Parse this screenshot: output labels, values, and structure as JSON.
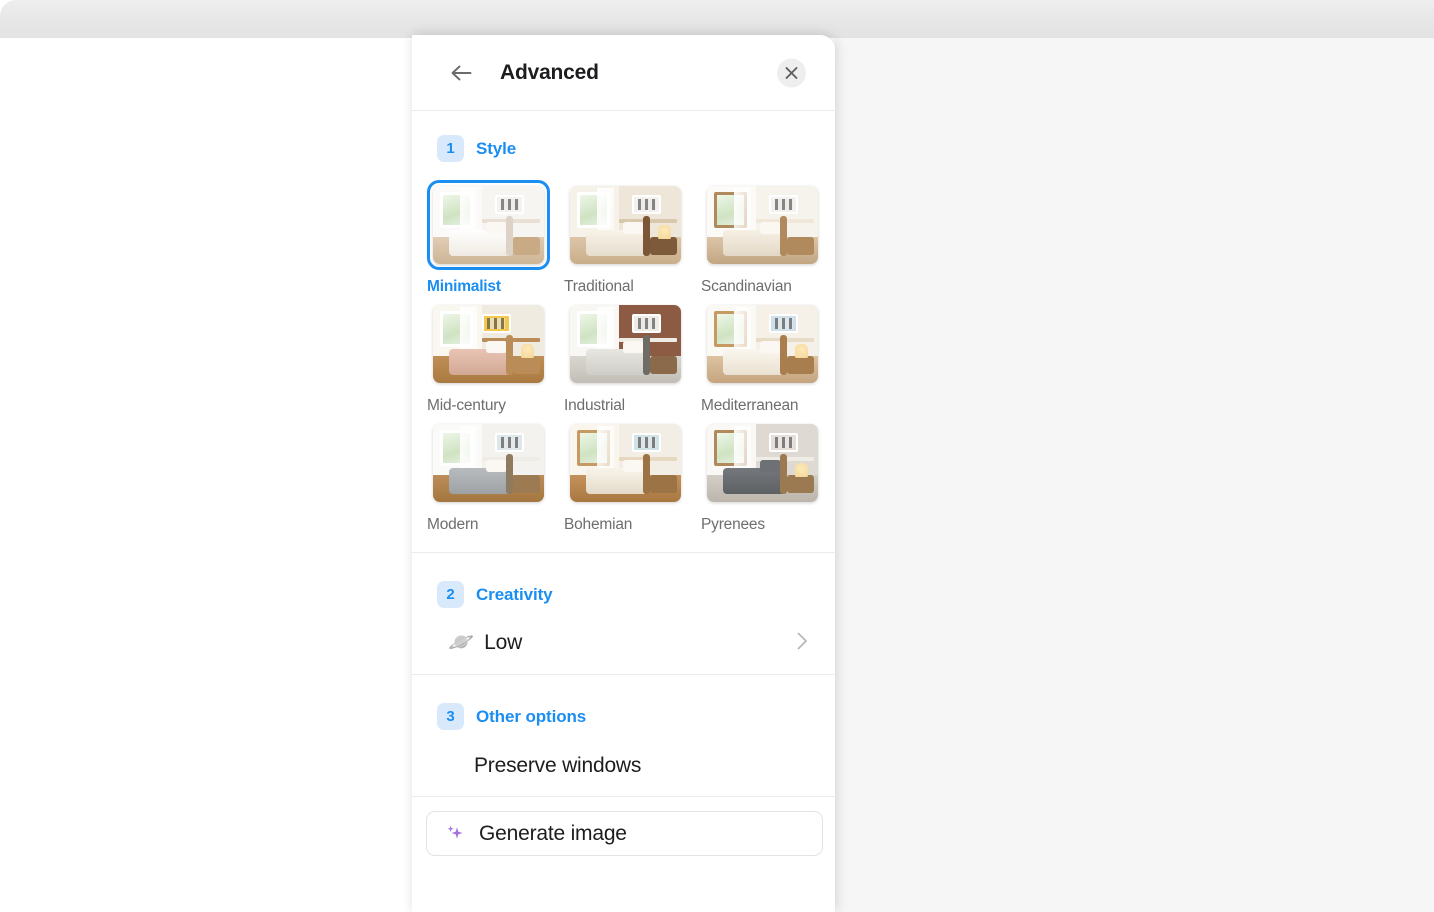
{
  "window": {
    "title": ""
  },
  "panel": {
    "title": "Advanced",
    "back_icon": "arrow-left-icon",
    "close_icon": "close-icon"
  },
  "sections": [
    {
      "step": "1",
      "title": "Style"
    },
    {
      "step": "2",
      "title": "Creativity"
    },
    {
      "step": "3",
      "title": "Other options"
    }
  ],
  "style": {
    "selected": "Minimalist",
    "options": [
      {
        "label": "Minimalist",
        "selected": true
      },
      {
        "label": "Traditional",
        "selected": false
      },
      {
        "label": "Scandinavian",
        "selected": false
      },
      {
        "label": "Mid-century",
        "selected": false
      },
      {
        "label": "Industrial",
        "selected": false
      },
      {
        "label": "Mediterranean",
        "selected": false
      },
      {
        "label": "Modern",
        "selected": false
      },
      {
        "label": "Bohemian",
        "selected": false
      },
      {
        "label": "Pyrenees",
        "selected": false
      }
    ]
  },
  "creativity": {
    "value": "Low",
    "icon": "saturn-planet-icon",
    "chevron_icon": "chevron-right-icon"
  },
  "other_options": {
    "preserve_windows_label": "Preserve windows"
  },
  "footer": {
    "generate_label": "Generate image",
    "generate_icon": "sparkles-icon"
  },
  "colors": {
    "accent_blue": "#1b8ef2",
    "badge_bg": "#d9e9fc",
    "sparkle_purple": "#a472e0",
    "panel_bg": "#ffffff",
    "workspace_bg": "#f6f6f6",
    "divider": "#ebebeb"
  }
}
